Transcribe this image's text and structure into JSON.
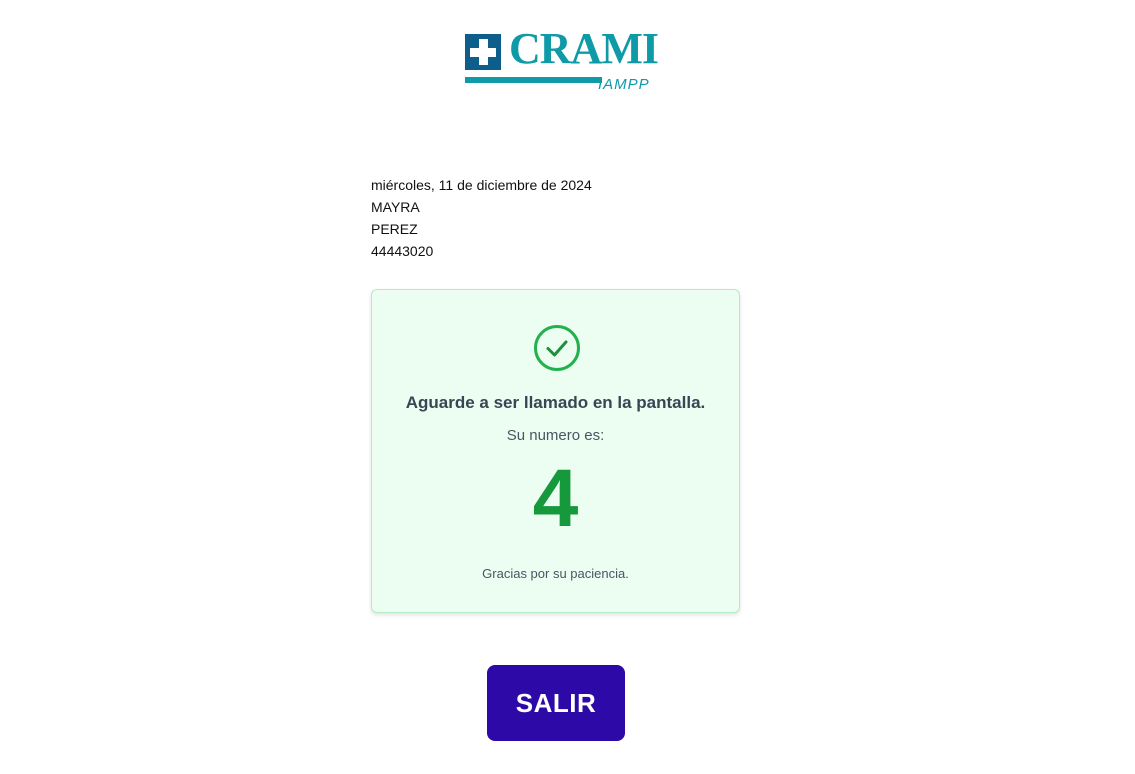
{
  "logo": {
    "name": "CRAMI",
    "subtitle": "IAMPP"
  },
  "info": {
    "date": "miércoles, 11 de diciembre de 2024",
    "first_name": "MAYRA",
    "last_name": "PEREZ",
    "document": "44443020"
  },
  "card": {
    "icon": "check-circle-icon",
    "title": "Aguarde a ser llamado en la pantalla.",
    "subtitle": "Su numero es:",
    "number": "4",
    "thanks": "Gracias por su paciencia."
  },
  "actions": {
    "exit_label": "SALIR"
  },
  "colors": {
    "brand_teal": "#0e9aa7",
    "brand_blue": "#0e5e8c",
    "success_green": "#15993c",
    "card_background": "#ecfdf1",
    "button_purple": "#2d0aa8"
  }
}
